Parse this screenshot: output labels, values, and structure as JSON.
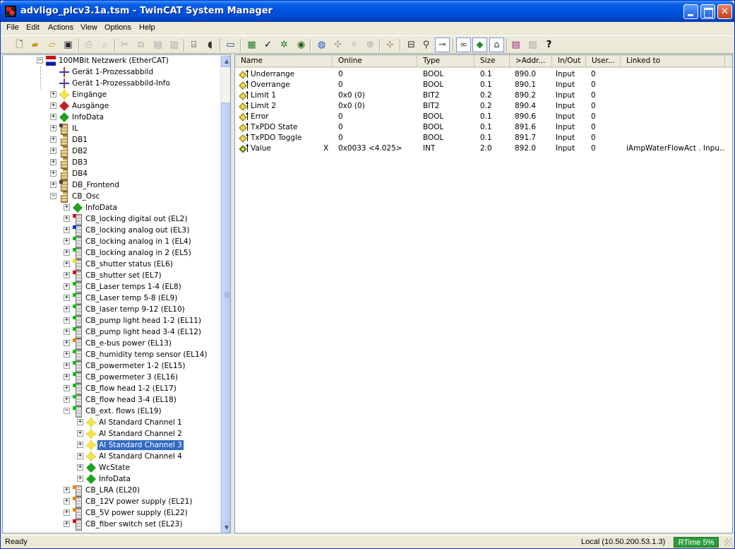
{
  "window": {
    "title": "advligo_plcv3.1a.tsm - TwinCAT System Manager"
  },
  "menu": [
    "File",
    "Edit",
    "Actions",
    "View",
    "Options",
    "Help"
  ],
  "toolbar": {
    "icons": [
      "new-icon",
      "open-icon",
      "open-folder-icon",
      "save-icon",
      "print-icon",
      "print-preview-icon",
      "cut-icon",
      "copy-icon",
      "paste-icon",
      "paste-with-links-icon",
      "find-icon",
      "mouse-icon",
      "target-system-icon",
      "generate-mappings-icon",
      "check-configuration-icon",
      "activate-configuration-icon",
      "restart-icon",
      "choose-target-icon",
      "scan-devices-icon",
      "toggle-free-run-icon",
      "show-variables-icon",
      "show-online-data-icon",
      "zoom-icon",
      "link-variable-icon",
      "watch-icon",
      "mapping-icon",
      "find-link-icon",
      "book-icon",
      "calculator-icon",
      "help-icon"
    ]
  },
  "tree": {
    "items": [
      {
        "label": "100MBit Netzwerk (EtherCAT)",
        "icon": "network-icon",
        "level": 0,
        "expander": "-"
      },
      {
        "label": "Gerät 1-Prozessabbild",
        "icon": "process-image-icon",
        "level": 1,
        "expander": ""
      },
      {
        "label": "Gerät 1-Prozessabbild-Info",
        "icon": "process-image-icon",
        "level": 1,
        "expander": ""
      },
      {
        "label": "Eingänge",
        "icon": "inputs-icon",
        "level": 1,
        "expander": "+"
      },
      {
        "label": "Ausgänge",
        "icon": "outputs-icon",
        "level": 1,
        "expander": "+"
      },
      {
        "label": "InfoData",
        "icon": "infodata-icon",
        "level": 1,
        "expander": "+"
      },
      {
        "label": "IL",
        "icon": "terminal-box-icon",
        "level": 1,
        "expander": "+",
        "color": "#444444"
      },
      {
        "label": "DB1",
        "icon": "terminal-box-icon",
        "level": 1,
        "expander": "+",
        "color": "#ffffff"
      },
      {
        "label": "DB2",
        "icon": "terminal-box-icon",
        "level": 1,
        "expander": "+",
        "color": "#ffffff"
      },
      {
        "label": "DB3",
        "icon": "terminal-box-icon",
        "level": 1,
        "expander": "+",
        "color": "#ffffff"
      },
      {
        "label": "DB4",
        "icon": "terminal-box-icon",
        "level": 1,
        "expander": "+",
        "color": "#ffffff"
      },
      {
        "label": "DB_Frontend",
        "icon": "terminal-box-icon",
        "level": 1,
        "expander": "+",
        "color": "#444444"
      },
      {
        "label": "CB_Osc",
        "icon": "terminal-box-icon",
        "level": 1,
        "expander": "-",
        "color": "#ffffff"
      },
      {
        "label": "InfoData",
        "icon": "infodata-icon",
        "level": 2,
        "expander": "+"
      },
      {
        "label": "CB_locking digital out (EL2)",
        "icon": "terminal-module-icon",
        "level": 2,
        "expander": "+",
        "color": "#e00000"
      },
      {
        "label": "CB_locking analog out (EL3)",
        "icon": "terminal-module-icon",
        "level": 2,
        "expander": "+",
        "color": "#0030e0"
      },
      {
        "label": "CB_locking analog in 1 (EL4)",
        "icon": "terminal-module-icon",
        "level": 2,
        "expander": "+",
        "color": "#00c000"
      },
      {
        "label": "CB_locking analog in 2 (EL5)",
        "icon": "terminal-module-icon",
        "level": 2,
        "expander": "+",
        "color": "#00c000"
      },
      {
        "label": "CB_shutter status (EL6)",
        "icon": "terminal-module-icon",
        "level": 2,
        "expander": "+",
        "color": "#f0e000"
      },
      {
        "label": "CB_shutter set (EL7)",
        "icon": "terminal-module-icon",
        "level": 2,
        "expander": "+",
        "color": "#e00000"
      },
      {
        "label": "CB_Laser temps 1-4 (EL8)",
        "icon": "terminal-module-icon",
        "level": 2,
        "expander": "+",
        "color": "#00c000"
      },
      {
        "label": "CB_Laser temp 5-8 (EL9)",
        "icon": "terminal-module-icon",
        "level": 2,
        "expander": "+",
        "color": "#00c000"
      },
      {
        "label": "CB_laser temp 9-12 (EL10)",
        "icon": "terminal-module-icon",
        "level": 2,
        "expander": "+",
        "color": "#00c000"
      },
      {
        "label": "CB_pump light head 1-2 (EL11)",
        "icon": "terminal-module-icon",
        "level": 2,
        "expander": "+",
        "color": "#00c000"
      },
      {
        "label": "CB_pump light head 3-4 (EL12)",
        "icon": "terminal-module-icon",
        "level": 2,
        "expander": "+",
        "color": "#00c000"
      },
      {
        "label": "CB_e-bus power (EL13)",
        "icon": "terminal-module-icon",
        "level": 2,
        "expander": "+",
        "color": "#f08000"
      },
      {
        "label": "CB_humidity temp sensor (EL14)",
        "icon": "terminal-module-icon",
        "level": 2,
        "expander": "+",
        "color": "#00c000"
      },
      {
        "label": "CB_powermeter 1-2 (EL15)",
        "icon": "terminal-module-icon",
        "level": 2,
        "expander": "+",
        "color": "#00c000"
      },
      {
        "label": "CB_powermeter 3 (EL16)",
        "icon": "terminal-module-icon",
        "level": 2,
        "expander": "+",
        "color": "#00c000"
      },
      {
        "label": "CB_flow head 1-2 (EL17)",
        "icon": "terminal-module-icon",
        "level": 2,
        "expander": "+",
        "color": "#00c000"
      },
      {
        "label": "CB_flow head 3-4 (EL18)",
        "icon": "terminal-module-icon",
        "level": 2,
        "expander": "+",
        "color": "#00c000"
      },
      {
        "label": "CB_ext. flows (EL19)",
        "icon": "terminal-module-icon",
        "level": 2,
        "expander": "-",
        "color": "#00c000"
      },
      {
        "label": "AI Standard Channel 1",
        "icon": "channel-icon",
        "level": 3,
        "expander": "+"
      },
      {
        "label": "AI Standard Channel 2",
        "icon": "channel-icon",
        "level": 3,
        "expander": "+"
      },
      {
        "label": "AI Standard Channel 3",
        "icon": "channel-icon",
        "level": 3,
        "expander": "+",
        "selected": true
      },
      {
        "label": "AI Standard Channel 4",
        "icon": "channel-icon",
        "level": 3,
        "expander": "+"
      },
      {
        "label": "WcState",
        "icon": "infodata-icon",
        "level": 3,
        "expander": "+"
      },
      {
        "label": "InfoData",
        "icon": "infodata-icon",
        "level": 3,
        "expander": "+"
      },
      {
        "label": "CB_LRA (EL20)",
        "icon": "terminal-module-icon",
        "level": 2,
        "expander": "+",
        "color": "#f08000"
      },
      {
        "label": "CB_12V power supply (EL21)",
        "icon": "terminal-module-icon",
        "level": 2,
        "expander": "+",
        "color": "#f08000"
      },
      {
        "label": "CB_5V power supply (EL22)",
        "icon": "terminal-module-icon",
        "level": 2,
        "expander": "+",
        "color": "#f08000"
      },
      {
        "label": "CB_fiber switch set (EL23)",
        "icon": "terminal-module-icon",
        "level": 2,
        "expander": "+",
        "color": "#e00000"
      }
    ]
  },
  "list": {
    "columns": [
      "Name",
      "Online",
      "Type",
      "Size",
      ">Addr...",
      "In/Out",
      "User...",
      "Linked to"
    ],
    "rows": [
      {
        "name": "Underrange",
        "flag": "",
        "online": "0",
        "type": "BOOL",
        "size": "0.1",
        "addr": "890.0",
        "inout": "Input",
        "user": "0",
        "linked": ""
      },
      {
        "name": "Overrange",
        "flag": "",
        "online": "0",
        "type": "BOOL",
        "size": "0.1",
        "addr": "890.1",
        "inout": "Input",
        "user": "0",
        "linked": ""
      },
      {
        "name": "Limit 1",
        "flag": "",
        "online": "0x0 (0)",
        "type": "BIT2",
        "size": "0.2",
        "addr": "890.2",
        "inout": "Input",
        "user": "0",
        "linked": ""
      },
      {
        "name": "Limit 2",
        "flag": "",
        "online": "0x0 (0)",
        "type": "BIT2",
        "size": "0.2",
        "addr": "890.4",
        "inout": "Input",
        "user": "0",
        "linked": ""
      },
      {
        "name": "Error",
        "flag": "",
        "online": "0",
        "type": "BOOL",
        "size": "0.1",
        "addr": "890.6",
        "inout": "Input",
        "user": "0",
        "linked": ""
      },
      {
        "name": "TxPDO State",
        "flag": "",
        "online": "0",
        "type": "BOOL",
        "size": "0.1",
        "addr": "891.6",
        "inout": "Input",
        "user": "0",
        "linked": ""
      },
      {
        "name": "TxPDO Toggle",
        "flag": "",
        "online": "0",
        "type": "BOOL",
        "size": "0.1",
        "addr": "891.7",
        "inout": "Input",
        "user": "0",
        "linked": ""
      },
      {
        "name": "Value",
        "flag": "X",
        "online": "0x0033 <4.025>",
        "type": "INT",
        "size": "2.0",
        "addr": "892.0",
        "inout": "Input",
        "user": "0",
        "linked": "iAmpWaterFlowAct . Inpu..."
      }
    ]
  },
  "status": {
    "text": "Ready",
    "target": "Local (10.50.200.53.1.3)",
    "rtime": "RTime 5%",
    "rtime_color": "#2c9d3c"
  }
}
